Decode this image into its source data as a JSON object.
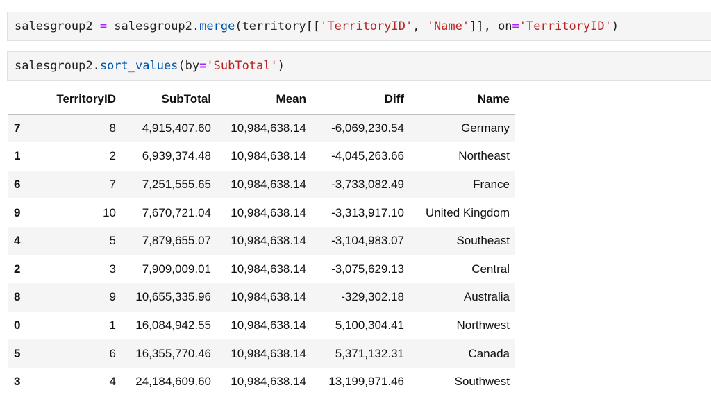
{
  "cells": [
    {
      "tokens": [
        {
          "text": "salesgroup2 ",
          "kind": "plain"
        },
        {
          "text": "=",
          "kind": "op"
        },
        {
          "text": " salesgroup2.",
          "kind": "plain"
        },
        {
          "text": "merge",
          "kind": "fn"
        },
        {
          "text": "(territory[[",
          "kind": "plain"
        },
        {
          "text": "'TerritoryID'",
          "kind": "str"
        },
        {
          "text": ", ",
          "kind": "plain"
        },
        {
          "text": "'Name'",
          "kind": "str"
        },
        {
          "text": "]], on",
          "kind": "plain"
        },
        {
          "text": "=",
          "kind": "op"
        },
        {
          "text": "'TerritoryID'",
          "kind": "str"
        },
        {
          "text": ")",
          "kind": "plain"
        }
      ]
    },
    {
      "tokens": [
        {
          "text": "salesgroup2.",
          "kind": "plain"
        },
        {
          "text": "sort_values",
          "kind": "fn"
        },
        {
          "text": "(by",
          "kind": "plain"
        },
        {
          "text": "=",
          "kind": "op"
        },
        {
          "text": "'SubTotal'",
          "kind": "str"
        },
        {
          "text": ")",
          "kind": "plain"
        }
      ]
    }
  ],
  "table": {
    "columns": [
      "",
      "TerritoryID",
      "SubTotal",
      "Mean",
      "Diff",
      "Name"
    ],
    "rows": [
      {
        "index": "7",
        "territory_id": "8",
        "subtotal": "4,915,407.60",
        "mean": "10,984,638.14",
        "diff": "-6,069,230.54",
        "name": "Germany"
      },
      {
        "index": "1",
        "territory_id": "2",
        "subtotal": "6,939,374.48",
        "mean": "10,984,638.14",
        "diff": "-4,045,263.66",
        "name": "Northeast"
      },
      {
        "index": "6",
        "territory_id": "7",
        "subtotal": "7,251,555.65",
        "mean": "10,984,638.14",
        "diff": "-3,733,082.49",
        "name": "France"
      },
      {
        "index": "9",
        "territory_id": "10",
        "subtotal": "7,670,721.04",
        "mean": "10,984,638.14",
        "diff": "-3,313,917.10",
        "name": "United Kingdom"
      },
      {
        "index": "4",
        "territory_id": "5",
        "subtotal": "7,879,655.07",
        "mean": "10,984,638.14",
        "diff": "-3,104,983.07",
        "name": "Southeast"
      },
      {
        "index": "2",
        "territory_id": "3",
        "subtotal": "7,909,009.01",
        "mean": "10,984,638.14",
        "diff": "-3,075,629.13",
        "name": "Central"
      },
      {
        "index": "8",
        "territory_id": "9",
        "subtotal": "10,655,335.96",
        "mean": "10,984,638.14",
        "diff": "-329,302.18",
        "name": "Australia"
      },
      {
        "index": "0",
        "territory_id": "1",
        "subtotal": "16,084,942.55",
        "mean": "10,984,638.14",
        "diff": "5,100,304.41",
        "name": "Northwest"
      },
      {
        "index": "5",
        "territory_id": "6",
        "subtotal": "16,355,770.46",
        "mean": "10,984,638.14",
        "diff": "5,371,132.31",
        "name": "Canada"
      },
      {
        "index": "3",
        "territory_id": "4",
        "subtotal": "24,184,609.60",
        "mean": "10,984,638.14",
        "diff": "13,199,971.46",
        "name": "Southwest"
      }
    ]
  },
  "colors": {
    "cell_background": "#f5f5f5",
    "operator": "#aa22ff",
    "function": "#0055aa",
    "string": "#ba2121",
    "striped_row": "#f5f5f5"
  }
}
